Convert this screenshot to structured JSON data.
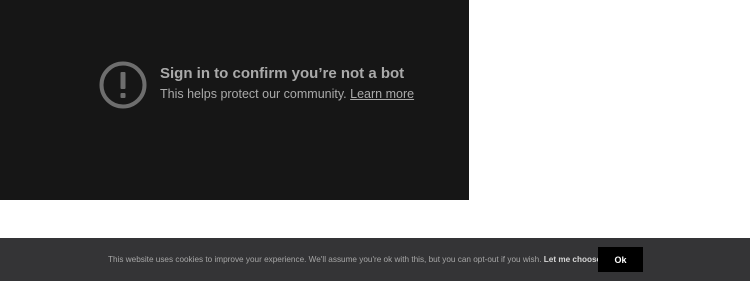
{
  "video": {
    "title": "Sign in to confirm you’re not a bot",
    "body": "This helps protect our community.",
    "link": "Learn more",
    "icon": "alert-circle-icon"
  },
  "cookie": {
    "text": "This website uses cookies to improve your experience. We'll assume you're ok with this, but you can opt-out if you wish.",
    "choose_label": "Let me choose",
    "chevron": "⌄",
    "ok_label": "Ok"
  }
}
